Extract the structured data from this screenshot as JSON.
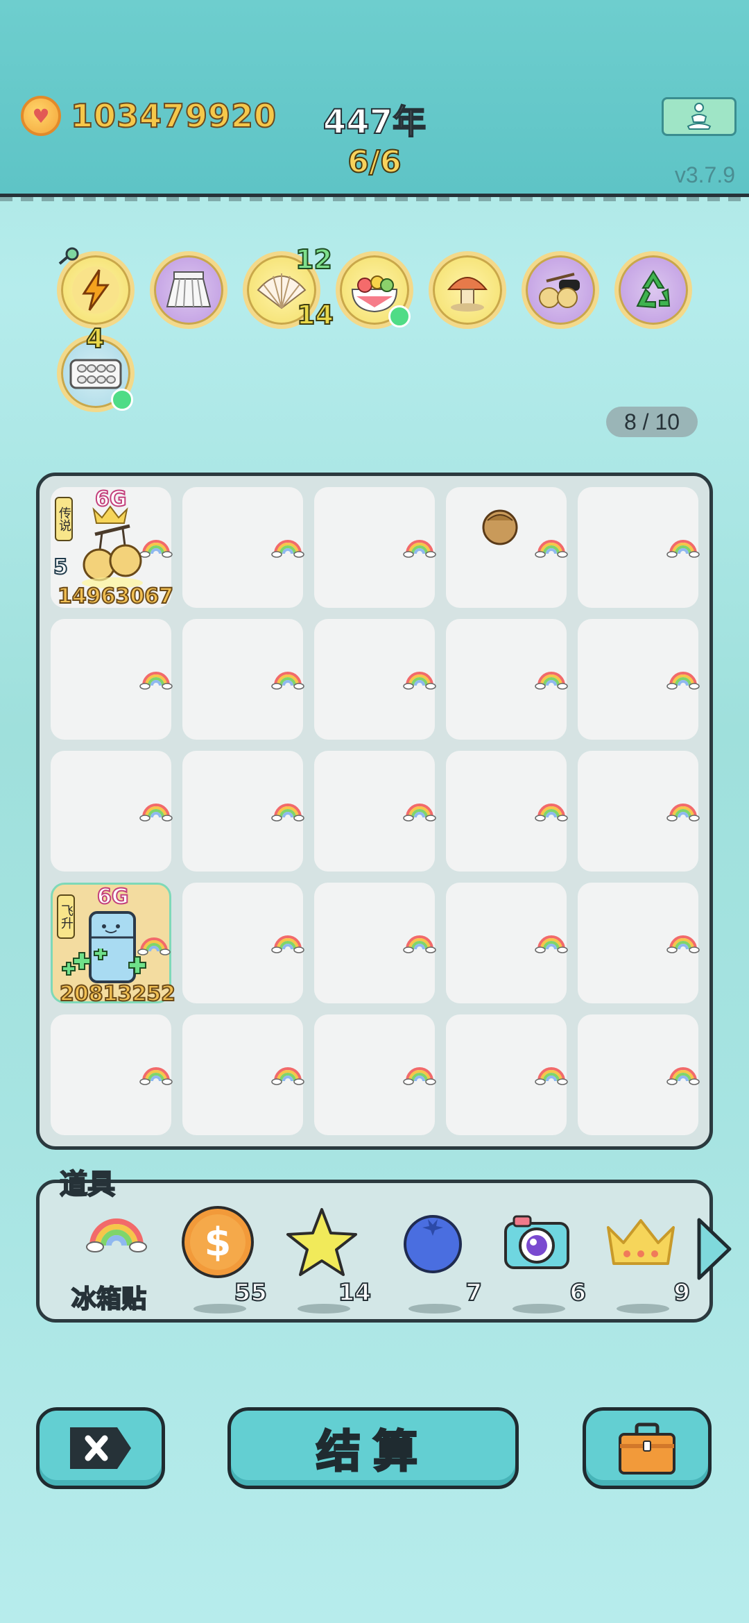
{
  "header": {
    "coins": "103479920",
    "year": "447年",
    "round": "6/6",
    "version": "v3.7.9",
    "meditate_icon": "meditation-person-icon"
  },
  "relics": [
    {
      "name": "lightning-relic-icon",
      "style": "yellow"
    },
    {
      "name": "skirt-relic-icon",
      "style": "purple"
    },
    {
      "name": "shell-relic-icon",
      "style": "yellow",
      "top_badge": "12",
      "bottom_badge": "14"
    },
    {
      "name": "fruit-salad-relic-icon",
      "style": "yellow",
      "dot": true
    },
    {
      "name": "mushroom-relic-icon",
      "style": "yellow"
    },
    {
      "name": "cherries-sunglasses-relic-icon",
      "style": "purple"
    },
    {
      "name": "recycle-relic-icon",
      "style": "purple"
    },
    {
      "name": "egg-tray-relic-icon",
      "style": "blue",
      "badge": "4",
      "dot": true
    }
  ],
  "slots_counter": "8 / 10",
  "board": {
    "special_cells": [
      {
        "row": 0,
        "col": 0,
        "tag": "传说",
        "gen": "6G",
        "level": "5",
        "value": "14963067",
        "item": "golden-cherries-icon"
      },
      {
        "row": 3,
        "col": 0,
        "tag": "飞升",
        "gen": "6G",
        "value": "20813252",
        "item": "fridge-icon"
      }
    ],
    "loose_item": {
      "row": 0,
      "col": 3,
      "item": "hazelnut-icon"
    }
  },
  "items_bar": {
    "title": "道具",
    "items": [
      {
        "name": "rainbow-sticker-icon",
        "label": "冰箱贴"
      },
      {
        "name": "dollar-coin-icon",
        "count": "55"
      },
      {
        "name": "star-icon",
        "count": "14"
      },
      {
        "name": "blueberry-icon",
        "count": "7"
      },
      {
        "name": "camera-icon",
        "count": "6"
      },
      {
        "name": "crown-icon",
        "count": "9"
      }
    ]
  },
  "buttons": {
    "close_icon": "close-x-icon",
    "settle": "结算",
    "bag_icon": "briefcase-icon"
  },
  "colors": {
    "accent": "#63cfd2",
    "gold": "#f5c84a",
    "outline": "#1f2b30"
  }
}
